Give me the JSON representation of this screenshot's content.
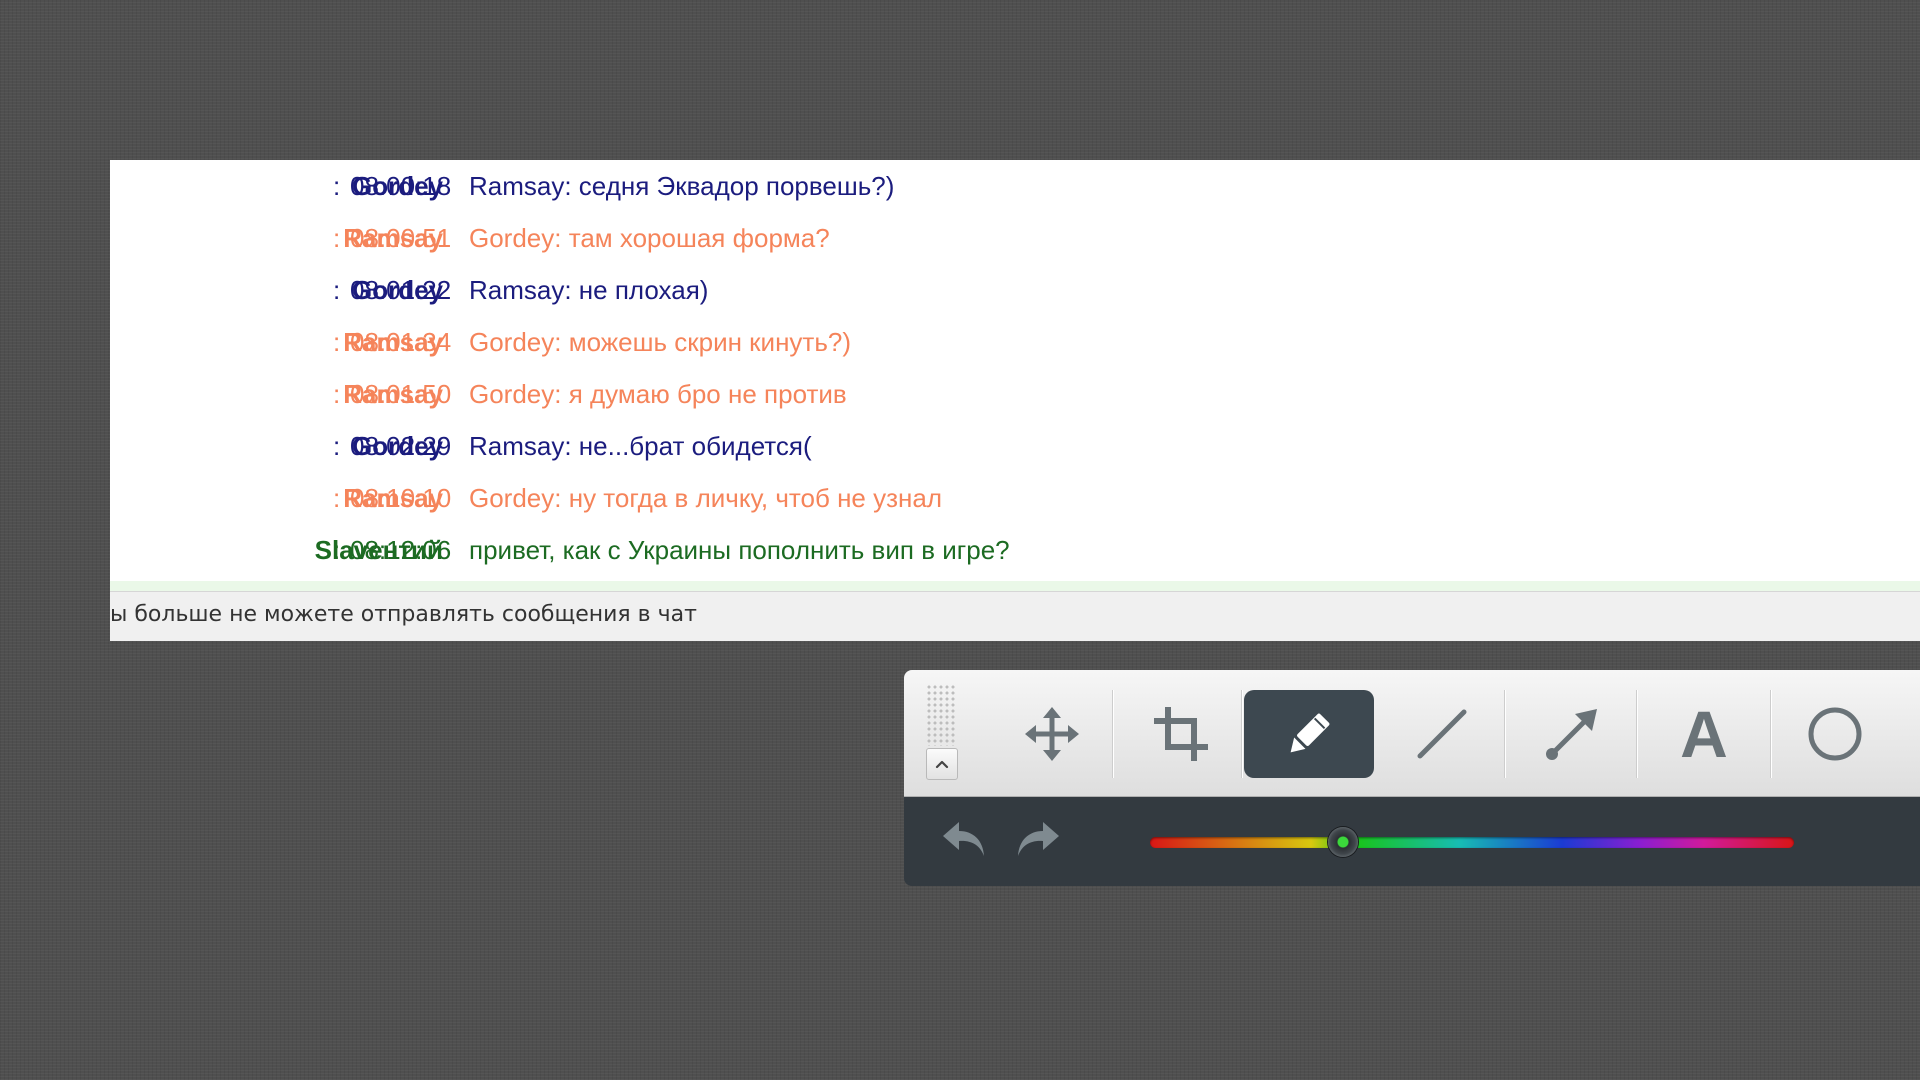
{
  "colors": {
    "nick_blue": "#1b1c7e",
    "nick_orange": "#f5845a",
    "nick_green": "#1c6b22",
    "toolbar_dark": "#333a40",
    "active_tool": "#3d4850"
  },
  "chat": {
    "messages": [
      {
        "nick": "Gordey",
        "sep": ":",
        "time": "08:00:18",
        "text": "Ramsay: седня Эквадор порвешь?)",
        "color": "blue"
      },
      {
        "nick": "Ramsay",
        "sep": ":",
        "time": "08:00:51",
        "text": "Gordey: там хорошая форма?",
        "color": "orange"
      },
      {
        "nick": "Gordey",
        "sep": ":",
        "time": "08:01:22",
        "text": "Ramsay: не плохая)",
        "color": "blue"
      },
      {
        "nick": "Ramsay",
        "sep": ":",
        "time": "08:01:34",
        "text": "Gordey: можешь скрин кинуть?)",
        "color": "orange"
      },
      {
        "nick": "Ramsay",
        "sep": ":",
        "time": "08:01:50",
        "text": "Gordey: я думаю бро не против",
        "color": "orange"
      },
      {
        "nick": "Gordey",
        "sep": ":",
        "time": "08:02:29",
        "text": "Ramsay: не...брат обидется(",
        "color": "blue"
      },
      {
        "nick": "Ramsay",
        "sep": ":",
        "time": "08:10:10",
        "text": "Gordey: ну тогда в личку, чтоб не узнал",
        "color": "orange"
      },
      {
        "nick": "Slavентий",
        "sep": ":",
        "time": "08:12:06",
        "text": "привет, как с Украины пополнить вип в игре?",
        "color": "green"
      }
    ],
    "status_text": "ы больше не можете отправлять сообщения в чат"
  },
  "toolbar": {
    "tools": [
      {
        "name": "move-tool",
        "icon": "move-icon",
        "active": false
      },
      {
        "name": "crop-tool",
        "icon": "crop-icon",
        "active": false
      },
      {
        "name": "pencil-tool",
        "icon": "pencil-icon",
        "active": true
      },
      {
        "name": "line-tool",
        "icon": "line-icon",
        "active": false
      },
      {
        "name": "arrow-tool",
        "icon": "arrow-icon",
        "active": false
      },
      {
        "name": "text-tool",
        "icon": "text-icon",
        "label": "A",
        "active": false
      },
      {
        "name": "ellipse-tool",
        "icon": "circle-icon",
        "active": false
      }
    ],
    "history": [
      "undo-icon",
      "redo-icon"
    ],
    "color_slider": {
      "value": 0.3,
      "selected_color": "#3bd83b"
    }
  }
}
